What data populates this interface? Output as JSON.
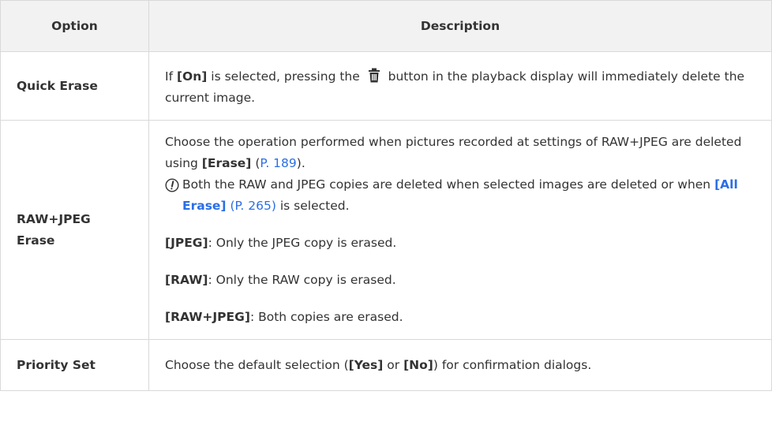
{
  "header": {
    "option": "Option",
    "description": "Description"
  },
  "rows": {
    "quick_erase": {
      "option": "Quick Erase",
      "desc_prefix": "If ",
      "desc_on": "[On]",
      "desc_mid": " is selected, pressing the ",
      "icon": "trash-icon",
      "desc_suffix": " button in the playback display will immediately delete the current image."
    },
    "raw_jpeg_erase": {
      "option": "RAW+JPEG Erase",
      "intro_prefix": "Choose the operation performed when pictures recorded at settings of RAW+JPEG are deleted using ",
      "intro_erase": "[Erase]",
      "intro_link": "P. 189",
      "intro_suffix": ").",
      "intro_open_paren": " (",
      "note_icon": "caution-icon",
      "note_prefix": "Both the RAW and JPEG copies are deleted when selected images are deleted or when ",
      "note_link_bold": "[All Erase]",
      "note_link": "(P. 265)",
      "note_suffix": " is selected.",
      "items": [
        {
          "key": "[JPEG]",
          "text": ": Only the JPEG copy is erased."
        },
        {
          "key": "[RAW]",
          "text": ": Only the RAW copy is erased."
        },
        {
          "key": "[RAW+JPEG]",
          "text": ": Both copies are erased."
        }
      ]
    },
    "priority_set": {
      "option": "Priority Set",
      "desc_prefix": "Choose the default selection (",
      "yes": "[Yes]",
      "or": " or ",
      "no": "[No]",
      "desc_suffix": ") for confirmation dialogs."
    }
  },
  "colors": {
    "link": "#2a6ee6",
    "header_bg": "#f2f2f2",
    "border": "#d9d9d9",
    "text": "#333333"
  }
}
